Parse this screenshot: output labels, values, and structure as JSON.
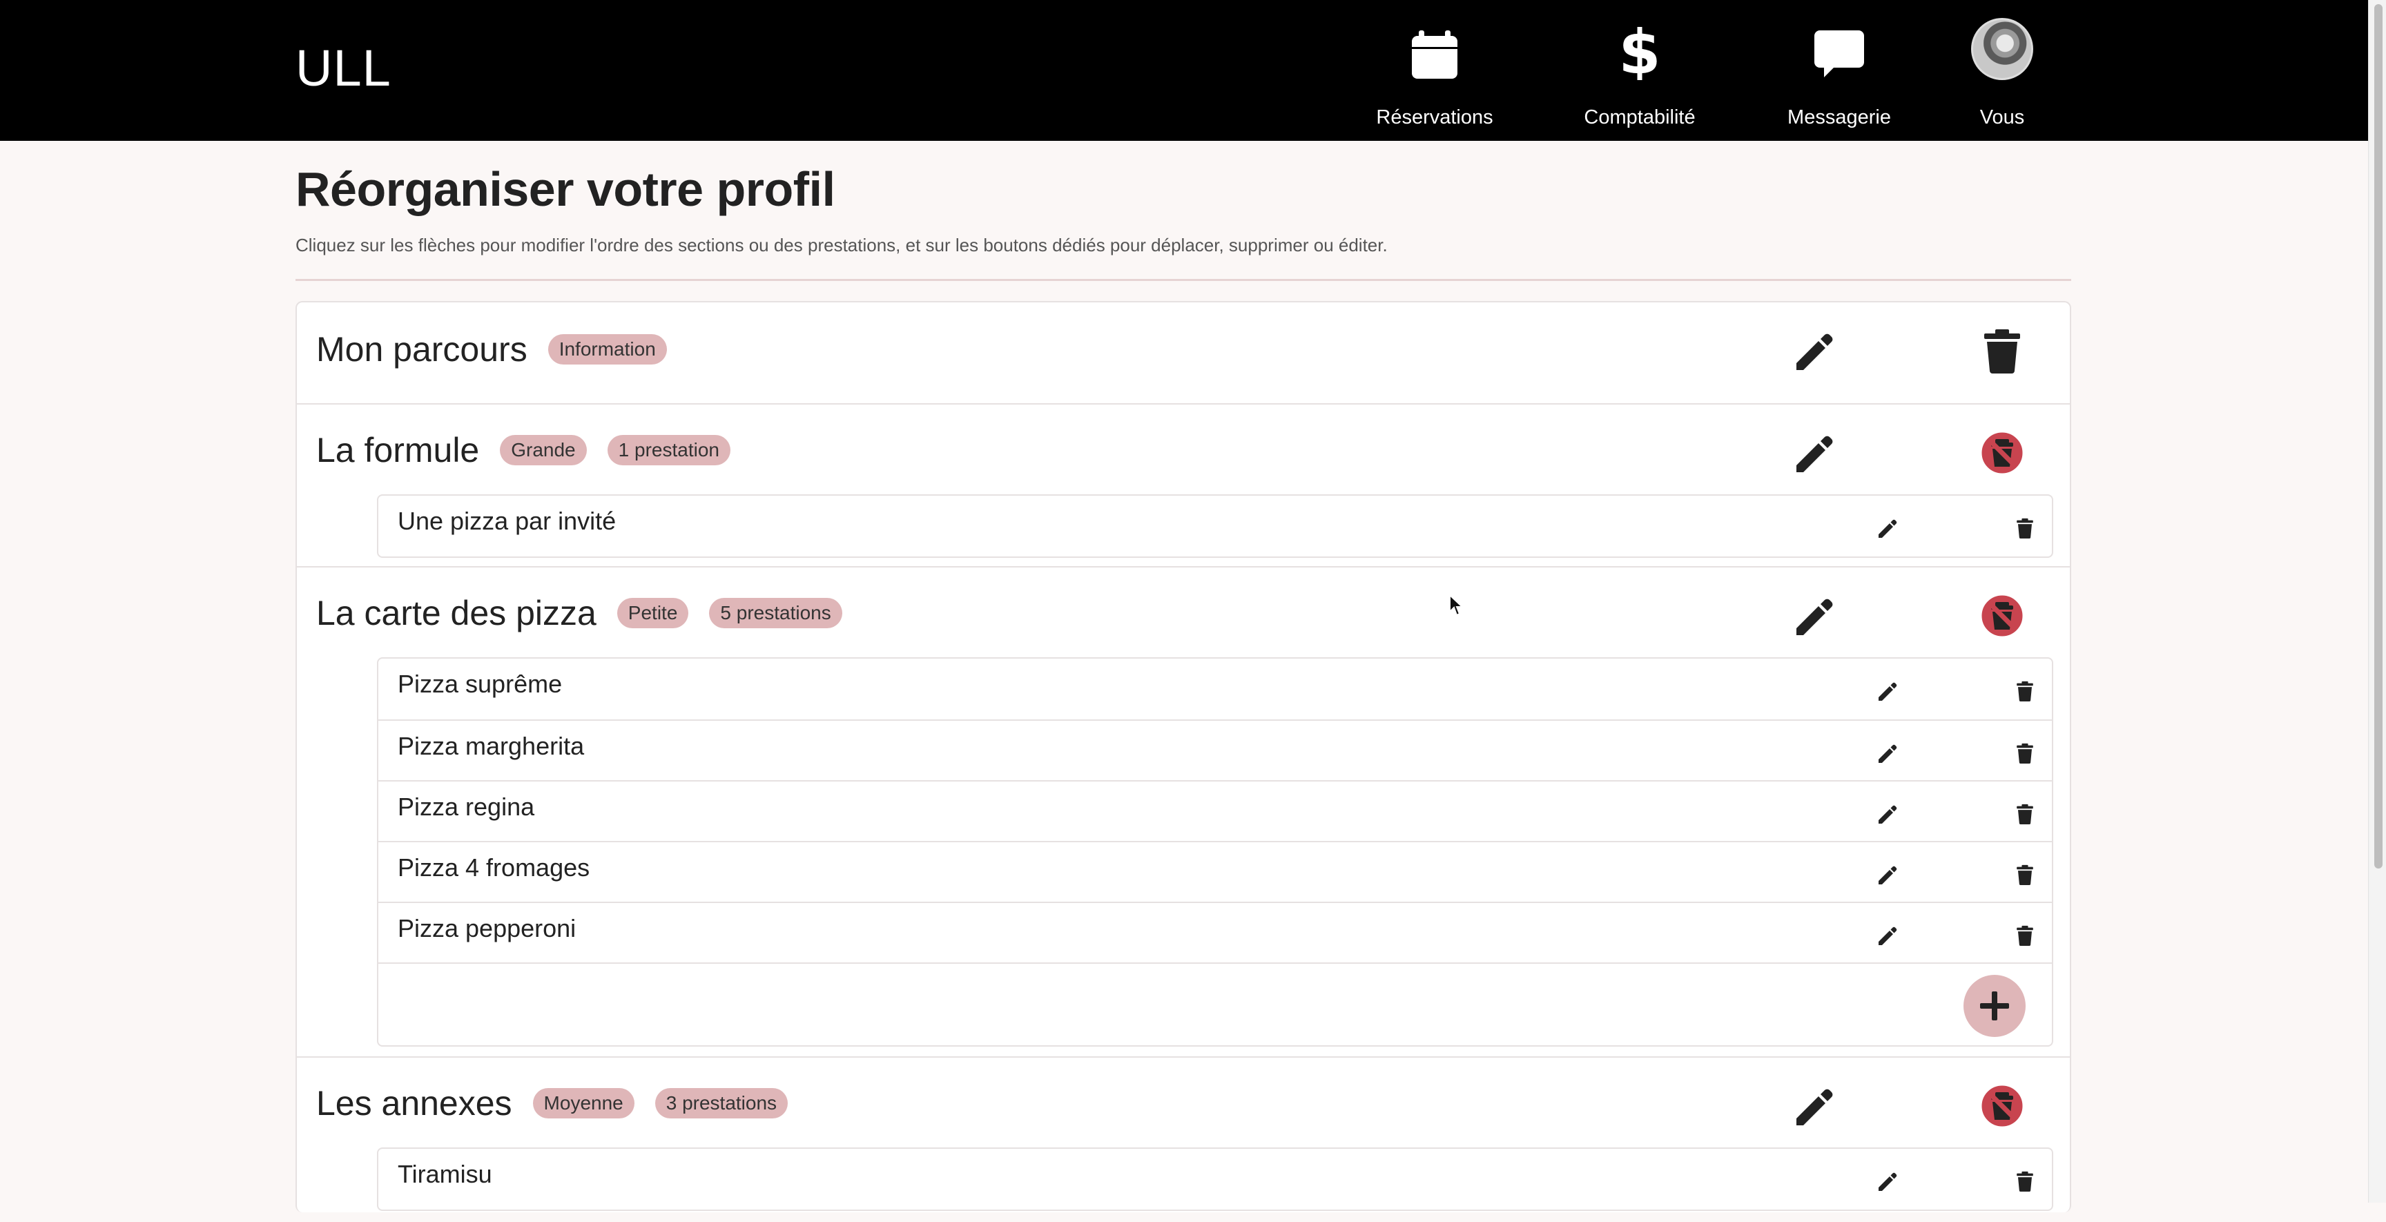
{
  "header": {
    "logo": "ULL",
    "nav": [
      {
        "label": "Réservations",
        "icon": "calendar-icon"
      },
      {
        "label": "Comptabilité",
        "icon": "dollar-icon"
      },
      {
        "label": "Messagerie",
        "icon": "message-icon"
      },
      {
        "label": "Vous",
        "icon": "avatar"
      }
    ]
  },
  "page": {
    "title": "Réorganiser votre profil",
    "subtitle": "Cliquez sur les flèches pour modifier l'ordre des sections ou des prestations, et sur les boutons dédiés pour déplacer, supprimer ou éditer."
  },
  "sections": [
    {
      "title": "Mon parcours",
      "badges": [
        "Information"
      ],
      "delete_state": "enabled",
      "items": []
    },
    {
      "title": "La formule",
      "badges": [
        "Grande",
        "1 prestation"
      ],
      "delete_state": "disabled",
      "items": [
        "Une pizza par invité"
      ]
    },
    {
      "title": "La carte des pizza",
      "badges": [
        "Petite",
        "5 prestations"
      ],
      "delete_state": "disabled",
      "items": [
        "Pizza suprême",
        "Pizza margherita",
        "Pizza regina",
        "Pizza 4 fromages",
        "Pizza pepperoni"
      ]
    },
    {
      "title": "Les annexes",
      "badges": [
        "Moyenne",
        "3 prestations"
      ],
      "delete_state": "disabled",
      "items": [
        "Tiramisu"
      ]
    }
  ],
  "colors": {
    "header_bg": "#000000",
    "badge_bg": "#dfb6b8",
    "disabled_icon": "#c8444f",
    "page_bg": "#fbf7f6"
  }
}
